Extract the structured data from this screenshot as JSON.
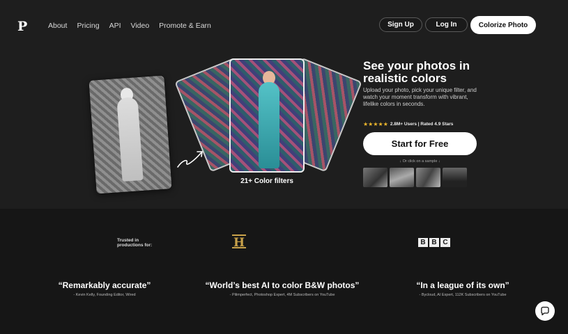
{
  "nav": {
    "logo": "P",
    "links": [
      "About",
      "Pricing",
      "API",
      "Video",
      "Promote & Earn"
    ],
    "signup": "Sign Up",
    "login": "Log In",
    "colorize": "Colorize Photo"
  },
  "hero": {
    "headline": "See your photos in realistic colors",
    "subtext": "Upload your photo, pick your unique filter, and watch your moment transform with vibrant, lifelike colors in seconds.",
    "stars": "★★★★★",
    "rating": "2.8M+ Users | Rated 4.9 Stars",
    "cta": "Start for Free",
    "sample_hint": "↓ Or click on a sample ↓",
    "filters_label": "21+ Color filters"
  },
  "trusted": {
    "label_line1": "Trusted in",
    "label_line2": "productions for:",
    "logos": [
      "history-logo",
      "bbc-logo"
    ],
    "history_text": "H",
    "bbc_letters": [
      "B",
      "B",
      "C"
    ]
  },
  "quotes": [
    {
      "text": "“Remarkably accurate”",
      "author": "- Kevin Kelly, Founding Editor, Wired"
    },
    {
      "text": "“World’s best AI to color B&W photos”",
      "author": "- Pilimperfect, Photoshop Expert, 4M Subscribers on YouTube"
    },
    {
      "text": "“In a league of its own”",
      "author": "- Bycloud, AI Expert, 112K Subscribers on YouTube"
    }
  ],
  "icons": {
    "chat": "chat-bubble-icon",
    "arrow": "curved-arrow-icon"
  },
  "colors": {
    "background": "#1e1e1e",
    "accent_star": "#f1b82d",
    "button_bg": "#ffffff"
  }
}
